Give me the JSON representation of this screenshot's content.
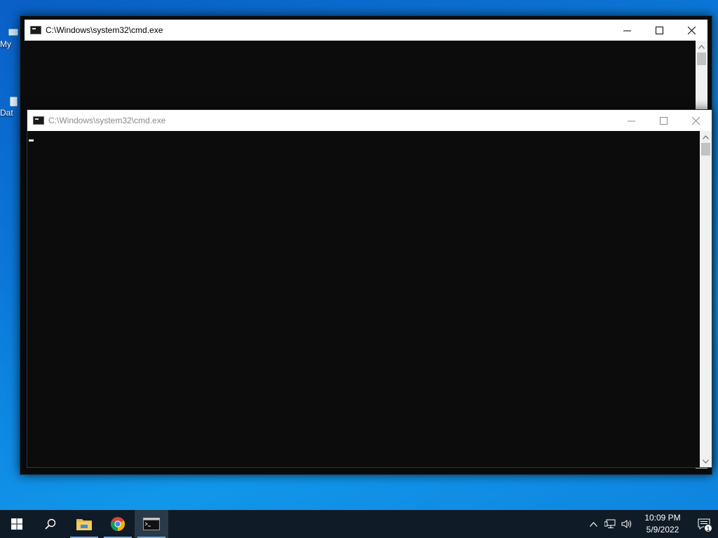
{
  "desktop": {
    "icons": [
      {
        "label": "My",
        "icon": "computer-icon"
      },
      {
        "label": "Dat",
        "icon": "file-icon"
      }
    ]
  },
  "windows": [
    {
      "title": "C:\\Windows\\system32\\cmd.exe",
      "state": "background"
    },
    {
      "title": "C:\\Windows\\system32\\cmd.exe",
      "state": "foreground"
    }
  ],
  "taskbar": {
    "buttons": [
      {
        "name": "start",
        "icon": "windows-logo-icon"
      },
      {
        "name": "search",
        "icon": "search-icon"
      },
      {
        "name": "file-explorer",
        "icon": "folder-icon"
      },
      {
        "name": "chrome",
        "icon": "chrome-icon"
      },
      {
        "name": "cmd",
        "icon": "terminal-icon"
      }
    ],
    "tray": {
      "time": "10:09 PM",
      "date": "5/9/2022",
      "notification_count": "1"
    }
  },
  "colors": {
    "console_bg": "#0c0c0c",
    "taskbar_bg": "#0f1b26",
    "titlebar_bg": "#ffffff"
  }
}
